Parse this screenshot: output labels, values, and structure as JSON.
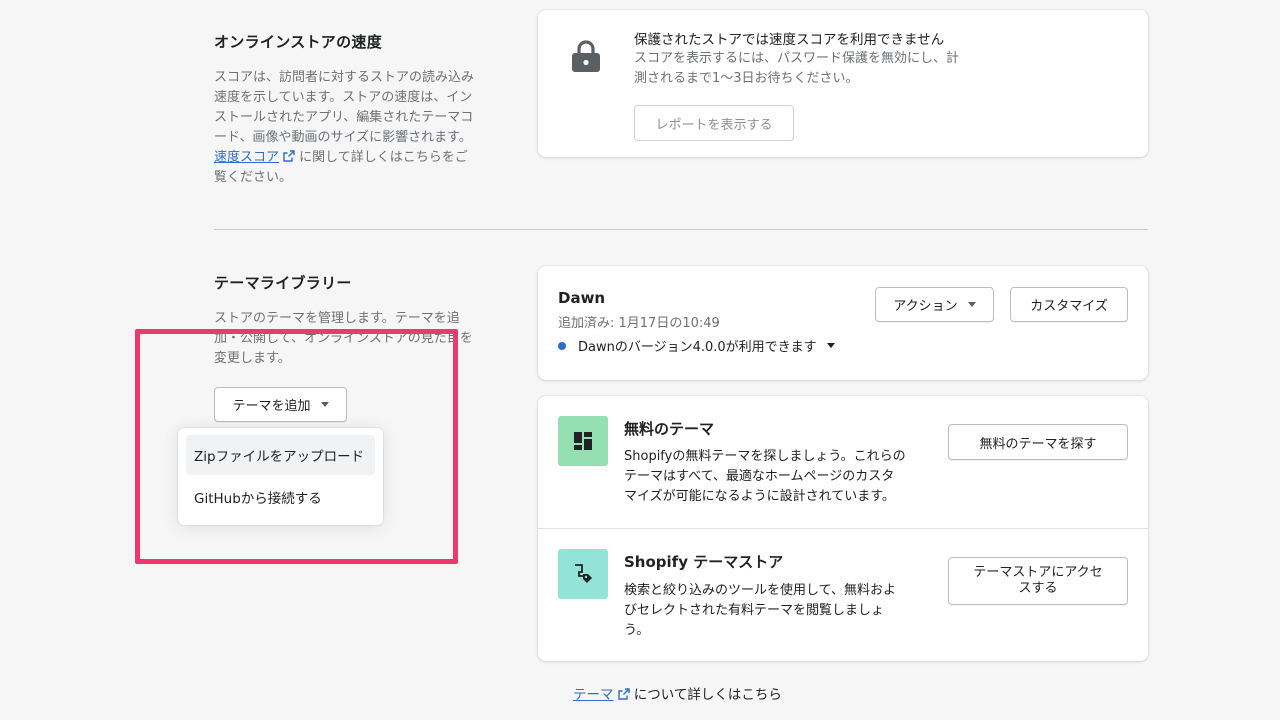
{
  "speed_section": {
    "title": "オンラインストアの速度",
    "desc_lines": [
      "スコアは、訪問者に対するストアの読み込み",
      "速度を示しています。ストアの速度は、イン",
      "ストールされたアプリ、編集されたテーマコ",
      "ード、画像や動画のサイズに影響されます。"
    ],
    "link_label": "速度スコア",
    "link_suffix": " に関して詳しくはこちらをご",
    "desc_last_line": "覧ください。",
    "card": {
      "icon": "lock-icon",
      "title": "保護されたストアでは速度スコアを利用できません",
      "body_lines": [
        "スコアを表示するには、パスワード保護を無効にし、計",
        "測されるまで1〜3日お待ちください。"
      ],
      "button_label": "レポートを表示する"
    }
  },
  "library_section": {
    "title": "テーマライブラリー",
    "desc_lines": [
      "ストアのテーマを管理します。テーマを追",
      "加・公開して、オンラインストアの見た目を",
      "変更します。"
    ],
    "add_button_label": "テーマを追加",
    "dropdown": {
      "items": [
        "Zipファイルをアップロード",
        "GitHubから接続する"
      ]
    },
    "current_theme": {
      "name": "Dawn",
      "added": "追加済み: 1月17日の10:49",
      "update_notice": "Dawnのバージョン4.0.0が利用できます",
      "action_label": "アクション",
      "customize_label": "カスタマイズ",
      "dot_color": "#2c6ecb"
    },
    "free_themes": {
      "title": "無料のテーマ",
      "body_lines": [
        "Shopifyの無料テーマを探しましょう。これらの",
        "テーマはすべて、最適なホームページのカスタ",
        "マイズが可能になるように設計されています。"
      ],
      "button_label": "無料のテーマを探す",
      "icon": "layout-icon",
      "icon_bg": "#95e0b3"
    },
    "theme_store": {
      "title": "Shopify テーマストア",
      "body_lines": [
        "検索と絞り込みのツールを使用して、無料およ",
        "びセレクトされた有料テーマを閲覧しましょ",
        "う。"
      ],
      "button_lines": [
        "テーマストアにアクセ",
        "スする"
      ],
      "icon": "store-tag-icon",
      "icon_bg": "#94e3d8"
    },
    "footer": {
      "link_label": "テーマ",
      "suffix": " について詳しくはこちら"
    }
  },
  "highlight_color": "#ec3a6d"
}
